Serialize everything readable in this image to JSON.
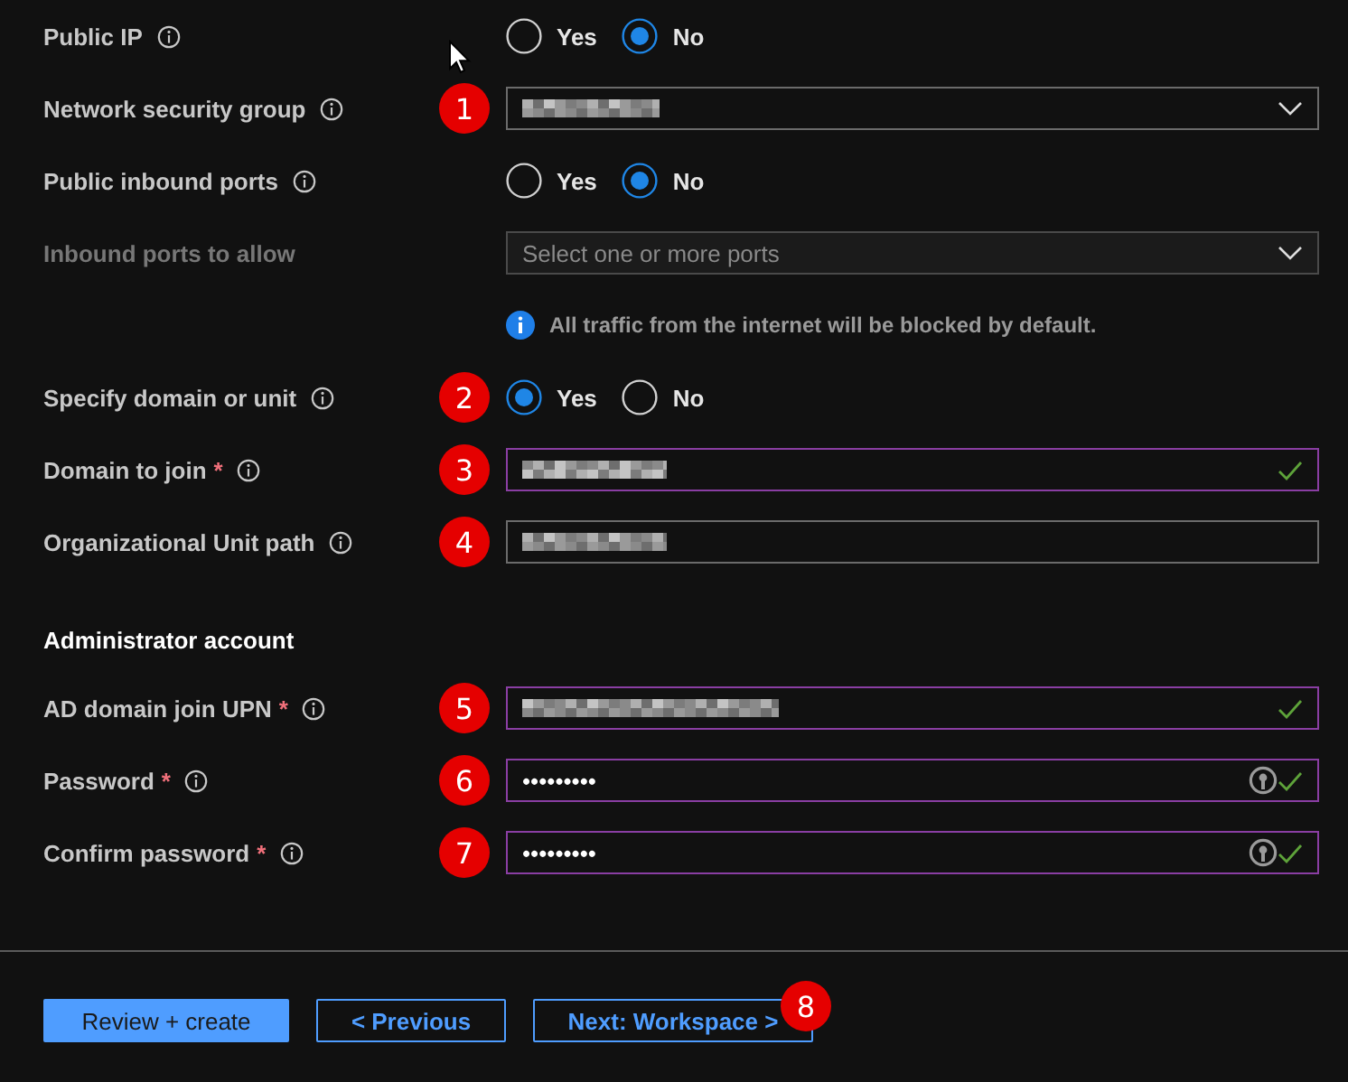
{
  "rows": [
    {
      "kind": "radio",
      "label": "Public IP",
      "info": true,
      "options": [
        {
          "label": "Yes",
          "selected": false
        },
        {
          "label": "No",
          "selected": true
        }
      ]
    },
    {
      "kind": "dropdown",
      "label": "Network security group",
      "info": true,
      "badge": "1",
      "blurred": true,
      "disabled": false
    },
    {
      "kind": "radio",
      "label": "Public inbound ports",
      "info": true,
      "options": [
        {
          "label": "Yes",
          "selected": false
        },
        {
          "label": "No",
          "selected": true
        }
      ]
    },
    {
      "kind": "dropdown",
      "label": "Inbound ports to allow",
      "info": false,
      "placeholder": "Select one or more ports",
      "disabled": true
    },
    {
      "kind": "note",
      "text": "All traffic from the internet will be blocked by default."
    },
    {
      "kind": "radio",
      "label": "Specify domain or unit",
      "info": true,
      "badge": "2",
      "options": [
        {
          "label": "Yes",
          "selected": true
        },
        {
          "label": "No",
          "selected": false
        }
      ]
    },
    {
      "kind": "text",
      "label": "Domain to join",
      "required_mark": "*",
      "info": true,
      "badge": "3",
      "blurred": true,
      "valid": true
    },
    {
      "kind": "text",
      "label": "Organizational Unit path",
      "info": true,
      "badge": "4",
      "blurred": true,
      "valid": false
    },
    {
      "kind": "heading",
      "text": "Administrator account"
    },
    {
      "kind": "text",
      "label": "AD domain join UPN",
      "required_mark": "*",
      "info": true,
      "badge": "5",
      "blurred": true,
      "valid": true
    },
    {
      "kind": "password",
      "label": "Password",
      "required_mark": "*",
      "info": true,
      "badge": "6",
      "value": "•••••••••",
      "valid": true
    },
    {
      "kind": "password",
      "label": "Confirm password",
      "required_mark": "*",
      "info": true,
      "badge": "7",
      "value": "•••••••••",
      "valid": true
    }
  ],
  "buttons": [
    {
      "label": "Review + create",
      "kind": "primary"
    },
    {
      "label": "< Previous",
      "kind": "secondary"
    },
    {
      "label": "Next: Workspace >",
      "kind": "secondary",
      "badge": "8"
    }
  ]
}
